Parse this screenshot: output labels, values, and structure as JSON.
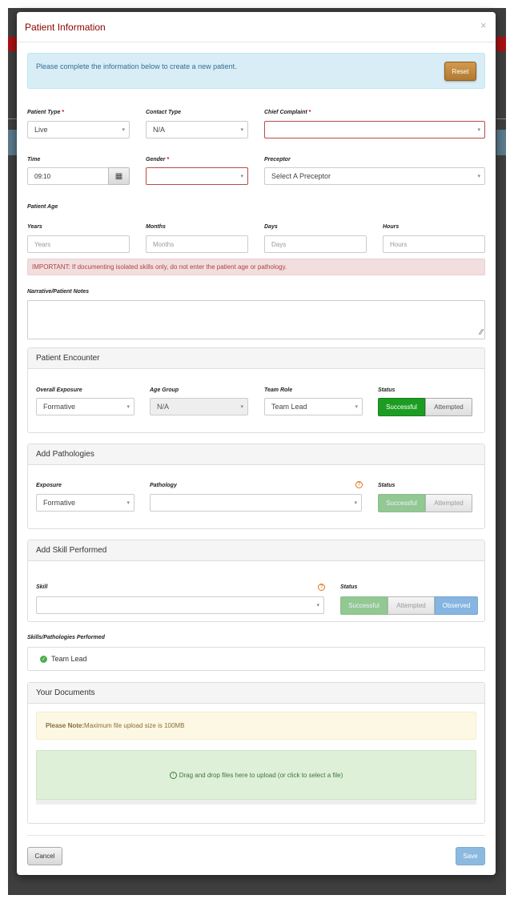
{
  "modal": {
    "title": "Patient Information",
    "close": "×"
  },
  "info": {
    "text": "Please complete the information below to create a new patient.",
    "reset_label": "Reset"
  },
  "form": {
    "patient_type": {
      "label": "Patient Type",
      "required": "*",
      "value": "Live"
    },
    "contact_type": {
      "label": "Contact Type",
      "value": "N/A"
    },
    "chief_complaint": {
      "label": "Chief Complaint",
      "required": "*",
      "value": ""
    },
    "time": {
      "label": "Time",
      "value": "09:10"
    },
    "gender": {
      "label": "Gender",
      "required": "*",
      "value": ""
    },
    "preceptor": {
      "label": "Preceptor",
      "value": "Select A Preceptor"
    },
    "patient_age_label": "Patient Age",
    "years": {
      "label": "Years",
      "placeholder": "Years"
    },
    "months": {
      "label": "Months",
      "placeholder": "Months"
    },
    "days": {
      "label": "Days",
      "placeholder": "Days"
    },
    "hours": {
      "label": "Hours",
      "placeholder": "Hours"
    },
    "important": "IMPORTANT: If documenting isolated skills only, do not enter the patient age or pathology.",
    "narrative_label": "Narrative/Patient Notes"
  },
  "encounter": {
    "title": "Patient Encounter",
    "exposure": {
      "label": "Overall Exposure",
      "value": "Formative"
    },
    "age_group": {
      "label": "Age Group",
      "value": "N/A"
    },
    "team_role": {
      "label": "Team Role",
      "value": "Team Lead"
    },
    "status": {
      "label": "Status",
      "successful": "Successful",
      "attempted": "Attempted"
    }
  },
  "pathologies": {
    "title": "Add Pathologies",
    "exposure": {
      "label": "Exposure",
      "value": "Formative"
    },
    "pathology": {
      "label": "Pathology",
      "value": ""
    },
    "status": {
      "label": "Status",
      "successful": "Successful",
      "attempted": "Attempted"
    }
  },
  "skill": {
    "title": "Add Skill Performed",
    "skill": {
      "label": "Skill",
      "value": ""
    },
    "status": {
      "label": "Status",
      "successful": "Successful",
      "attempted": "Attempted",
      "observed": "Observed"
    }
  },
  "performed": {
    "label": "Skills/Pathologies Performed",
    "items": [
      "Team Lead"
    ]
  },
  "documents": {
    "title": "Your Documents",
    "note_bold": "Please Note:",
    "note_text": " Maximum file upload size is 100MB",
    "dropzone": "Drag and drop files here to upload (or click to select a file)"
  },
  "footer": {
    "cancel": "Cancel",
    "save": "Save"
  },
  "icons": {
    "help": "?",
    "check": "✓",
    "upload": "↑",
    "calendar": "▦",
    "caret": "▾",
    "resize": "⁄⁄"
  },
  "colors": {
    "title_red": "#8b0000",
    "success": "#1c9d22",
    "info_bg": "#d9edf7",
    "danger_bg": "#f2dede",
    "reset": "#c58c40",
    "save": "#8cb9df"
  }
}
